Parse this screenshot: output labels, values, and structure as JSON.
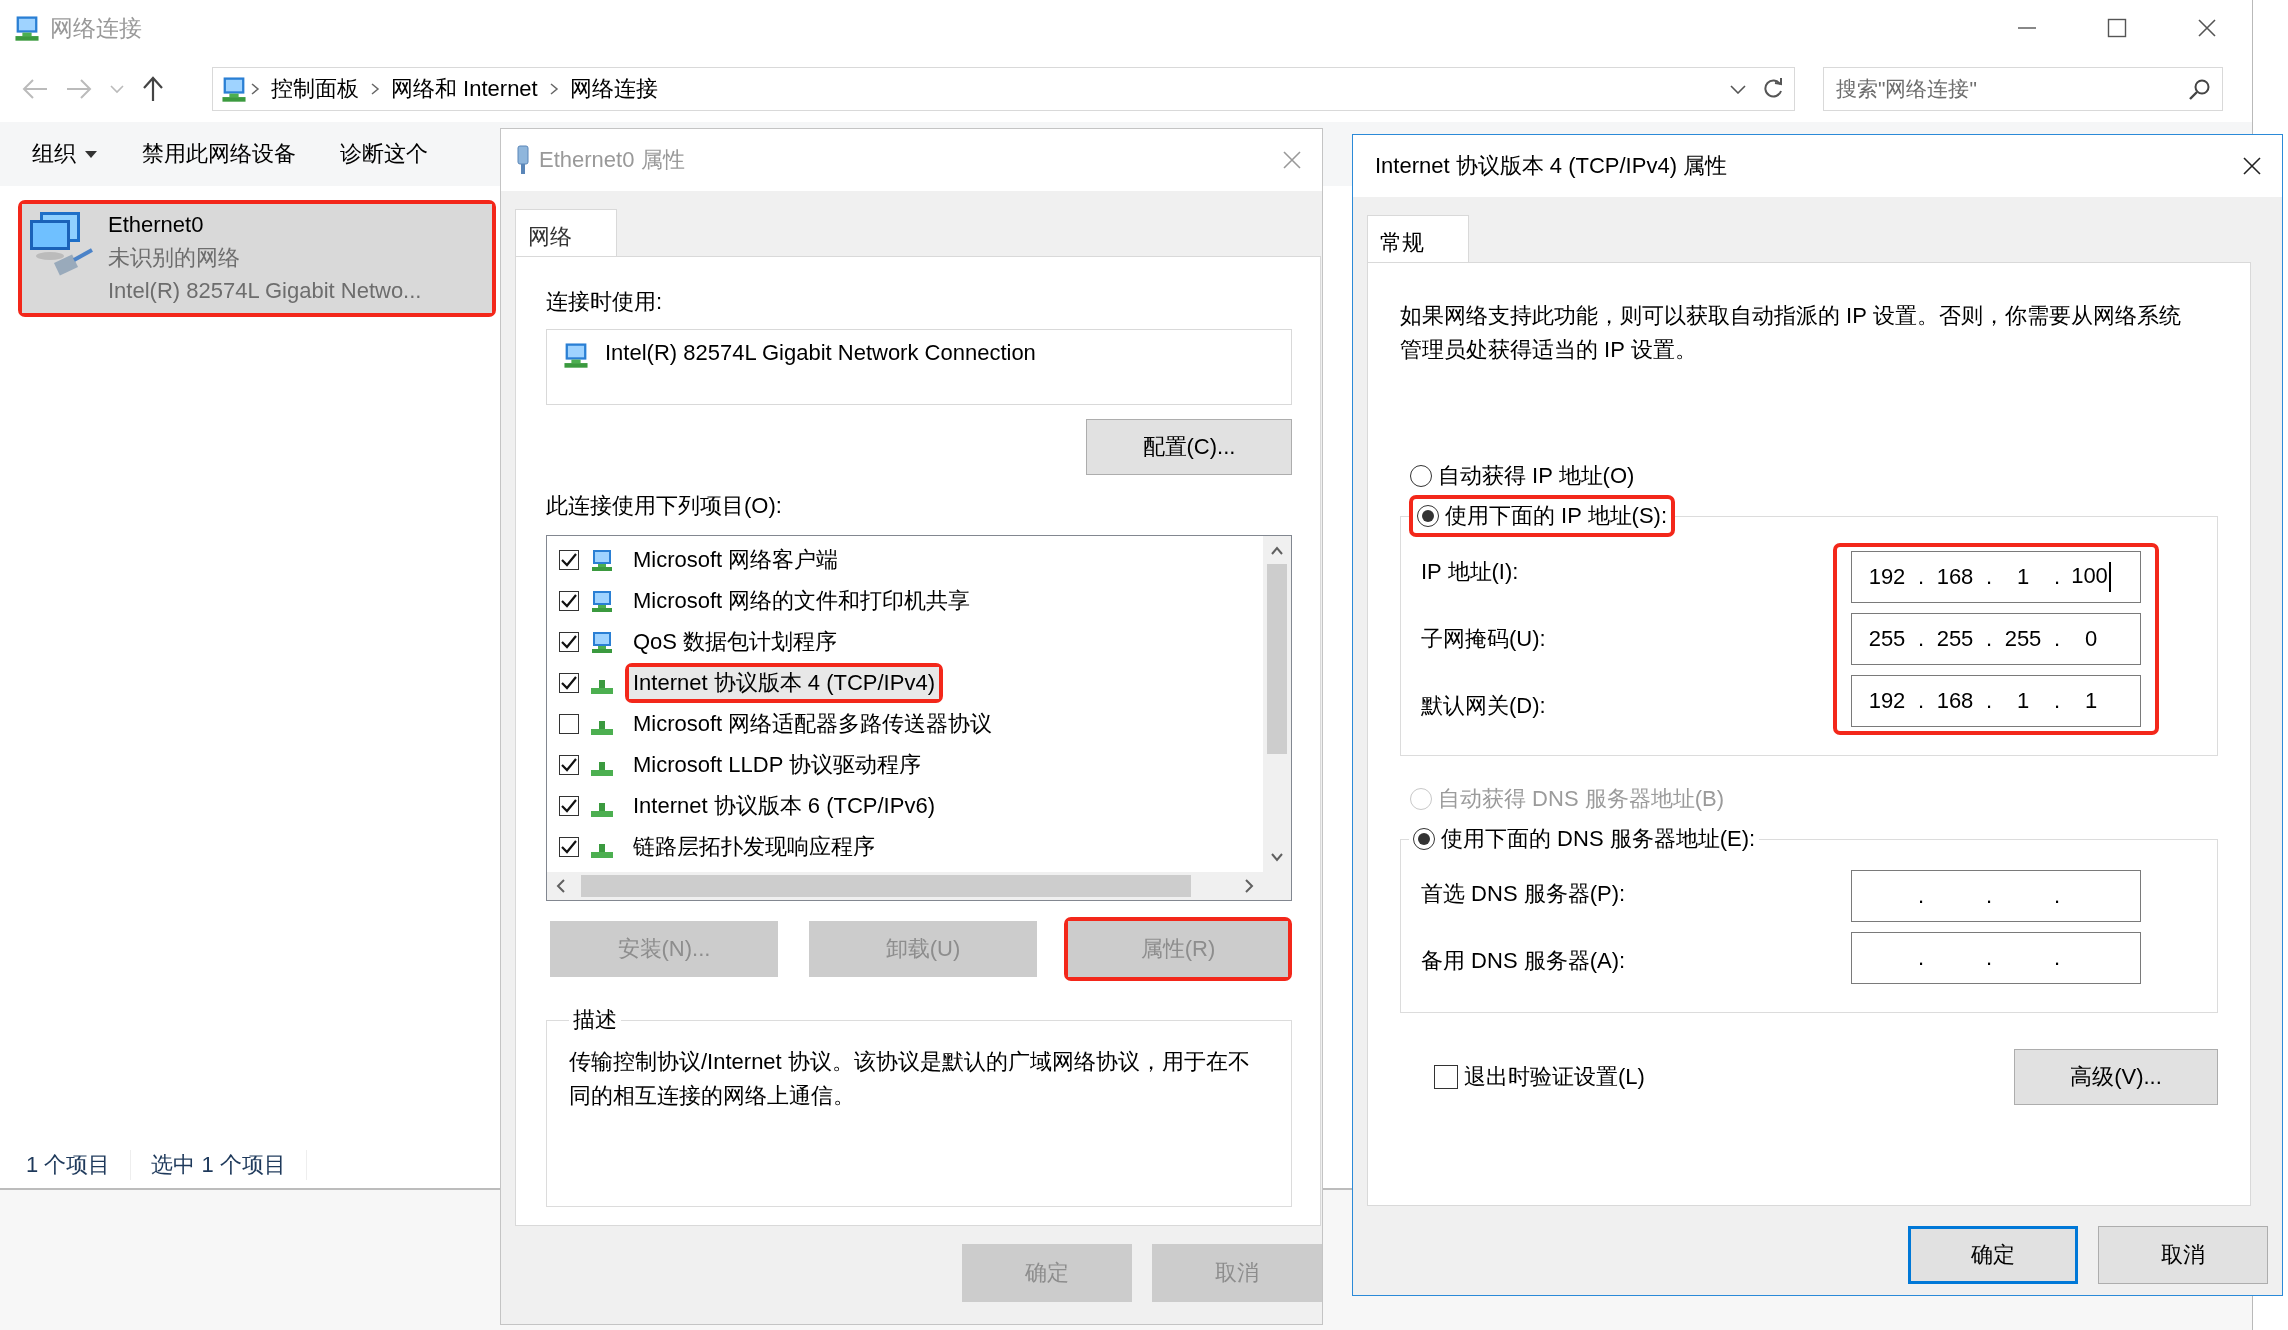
{
  "explorer": {
    "title": "网络连接",
    "active": false,
    "breadcrumbs": [
      "控制面板",
      "网络和 Internet",
      "网络连接"
    ],
    "search": {
      "placeholder": "搜索\"网络连接\""
    },
    "toolbar": [
      {
        "label": "组织",
        "kind": "menu"
      },
      {
        "label": "禁用此网络设备",
        "kind": "button"
      },
      {
        "label": "诊断这个",
        "kind": "button"
      }
    ],
    "items": [
      {
        "name": "Ethernet0",
        "status": "未识别的网络",
        "device": "Intel(R) 82574L Gigabit Netwo...",
        "selected": true,
        "highlighted": true
      }
    ],
    "status_bar": [
      "1 个项目",
      "选中 1 个项目"
    ]
  },
  "adapter_dialog": {
    "title": "Ethernet0 属性",
    "active": false,
    "tabs": [
      {
        "label": "网络",
        "selected": true
      }
    ],
    "connect_using_label": "连接时使用:",
    "adapter": "Intel(R) 82574L Gigabit Network Connection",
    "configure_button": "配置(C)...",
    "items_label": "此连接使用下列项目(O):",
    "components": [
      {
        "label": "Microsoft 网络客户端",
        "kind": "service",
        "checked": true,
        "selected": false,
        "highlighted": false
      },
      {
        "label": "Microsoft 网络的文件和打印机共享",
        "kind": "service",
        "checked": true,
        "selected": false,
        "highlighted": false
      },
      {
        "label": "QoS 数据包计划程序",
        "kind": "service",
        "checked": true,
        "selected": false,
        "highlighted": false
      },
      {
        "label": "Internet 协议版本 4 (TCP/IPv4)",
        "kind": "protocol",
        "checked": true,
        "selected": true,
        "highlighted": true
      },
      {
        "label": "Microsoft 网络适配器多路传送器协议",
        "kind": "protocol",
        "checked": false,
        "selected": false,
        "highlighted": false
      },
      {
        "label": "Microsoft LLDP 协议驱动程序",
        "kind": "protocol",
        "checked": true,
        "selected": false,
        "highlighted": false
      },
      {
        "label": "Internet 协议版本 6 (TCP/IPv6)",
        "kind": "protocol",
        "checked": true,
        "selected": false,
        "highlighted": false
      },
      {
        "label": "链路层拓扑发现响应程序",
        "kind": "protocol",
        "checked": true,
        "selected": false,
        "highlighted": false
      }
    ],
    "buttons": [
      {
        "label": "安装(N)...",
        "disabled": true,
        "highlighted": false
      },
      {
        "label": "卸载(U)",
        "disabled": true,
        "highlighted": false
      },
      {
        "label": "属性(R)",
        "disabled": true,
        "highlighted": true
      }
    ],
    "description_title": "描述",
    "description": "传输控制协议/Internet 协议。该协议是默认的广域网络协议，用于在不同的相互连接的网络上通信。",
    "footer_buttons": [
      {
        "label": "确定",
        "disabled": true,
        "default": false
      },
      {
        "label": "取消",
        "disabled": true,
        "default": false
      }
    ]
  },
  "ipv4_dialog": {
    "title": "Internet 协议版本 4 (TCP/IPv4) 属性",
    "active": true,
    "tabs": [
      {
        "label": "常规",
        "selected": true
      }
    ],
    "intro": "如果网络支持此功能，则可以获取自动指派的 IP 设置。否则，你需要从网络系统管理员处获得适当的 IP 设置。",
    "ip_auto": {
      "label": "自动获得 IP 地址(O)",
      "selected": false,
      "disabled": false
    },
    "ip_manual": {
      "label": "使用下面的 IP 地址(S):",
      "selected": true,
      "disabled": false,
      "highlighted": true
    },
    "ip_fields_highlighted": true,
    "ip_fields": [
      {
        "label": "IP 地址(I):",
        "separator": ".",
        "segments": [
          "192",
          "168",
          "1",
          "100"
        ],
        "focused": true
      },
      {
        "label": "子网掩码(U):",
        "separator": ".",
        "segments": [
          "255",
          "255",
          "255",
          "0"
        ],
        "focused": false
      },
      {
        "label": "默认网关(D):",
        "separator": ".",
        "segments": [
          "192",
          "168",
          "1",
          "1"
        ],
        "focused": false
      }
    ],
    "dns_auto": {
      "label": "自动获得 DNS 服务器地址(B)",
      "selected": false,
      "disabled": true
    },
    "dns_manual": {
      "label": "使用下面的 DNS 服务器地址(E):",
      "selected": true,
      "disabled": false
    },
    "dns_fields": [
      {
        "label": "首选 DNS 服务器(P):",
        "separator": ".",
        "focused": false
      },
      {
        "label": "备用 DNS 服务器(A):",
        "separator": ".",
        "focused": false
      }
    ],
    "validate_on_exit": {
      "label": "退出时验证设置(L)",
      "checked": false
    },
    "advanced_button": "高级(V)...",
    "footer_buttons": [
      {
        "label": "确定",
        "disabled": false,
        "default": true
      },
      {
        "label": "取消",
        "disabled": false,
        "default": false
      }
    ]
  }
}
